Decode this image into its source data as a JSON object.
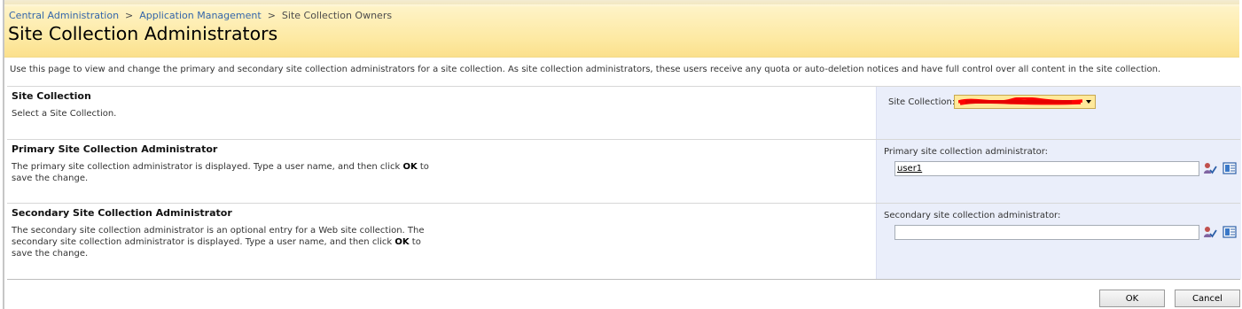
{
  "breadcrumb": {
    "items": [
      "Central Administration",
      "Application Management"
    ],
    "separator": ">",
    "current": "Site Collection Owners"
  },
  "page_title": "Site Collection Administrators",
  "description": "Use this page to view and change the primary and secondary site collection administrators for a site collection. As site collection administrators, these users receive any quota or auto-deletion notices and have full control over all content in the site collection.",
  "site_collection": {
    "title": "Site Collection",
    "description": "Select a Site Collection.",
    "field_label": "Site Collection:",
    "selected_value_redacted": true
  },
  "primary_admin": {
    "title": "Primary Site Collection Administrator",
    "desc_before": "The primary site collection administrator is displayed. Type a user name, and then click ",
    "desc_bold": "OK",
    "desc_after": " to save the change.",
    "field_label": "Primary site collection administrator:",
    "value": "user1"
  },
  "secondary_admin": {
    "title": "Secondary Site Collection Administrator",
    "desc_before": "The secondary site collection administrator is an optional entry for a Web site collection. The secondary site collection administrator is displayed. Type a user name, and then click ",
    "desc_bold": "OK",
    "desc_after": " to save the change.",
    "field_label": "Secondary site collection administrator:",
    "value": ""
  },
  "buttons": {
    "ok": "OK",
    "cancel": "Cancel"
  },
  "icons": {
    "check_names": "check-names-icon",
    "browse": "address-book-icon"
  },
  "colors": {
    "header_band": "#fde9a2",
    "panel": "#eaeefa",
    "link": "#3366aa",
    "redaction": "#ff0000"
  }
}
